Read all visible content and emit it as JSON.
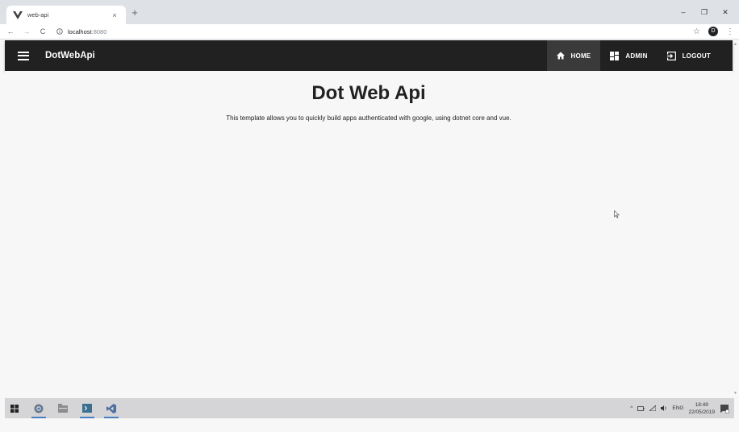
{
  "browser": {
    "tab_title": "web-api",
    "tab_close": "×",
    "new_tab": "+",
    "window_controls": {
      "minimize": "–",
      "restore": "❐",
      "close": "✕"
    },
    "nav": {
      "back": "←",
      "forward": "→",
      "reload": "C"
    },
    "url_host": "localhost",
    "url_port": ":8080",
    "profile_initial": "D",
    "bookmark": "☆",
    "menu": "⋮"
  },
  "app": {
    "title": "DotWebApi",
    "nav_items": [
      {
        "label": "HOME",
        "icon": "home-icon",
        "active": true
      },
      {
        "label": "ADMIN",
        "icon": "dashboard-icon",
        "active": false
      },
      {
        "label": "LOGOUT",
        "icon": "logout-icon",
        "active": false
      }
    ],
    "colors": {
      "toolbar": "#212121",
      "active_nav": "#3a3a3a",
      "page": "#f7f7f8"
    }
  },
  "page": {
    "heading": "Dot Web Api",
    "description": "This template allows you to quickly build apps authenticated with google, using dotnet core and vue."
  },
  "taskbar": {
    "apps": [
      "windows-start-icon",
      "chrome-icon",
      "file-explorer-icon",
      "powershell-icon",
      "visual-studio-icon"
    ],
    "language": "ENG",
    "time": "18:49",
    "date": "22/05/2019"
  }
}
